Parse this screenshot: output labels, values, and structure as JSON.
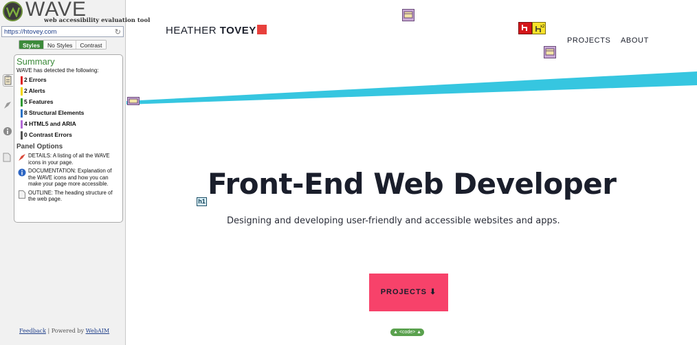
{
  "wave": {
    "logo_word": "WAVE",
    "logo_subtitle": "web accessibility evaluation tool",
    "url": "https://htovey.com",
    "style_toggle": [
      "Styles",
      "No Styles",
      "Contrast"
    ],
    "summary_title": "Summary",
    "summary_intro": "WAVE has detected the following:",
    "counts": [
      {
        "label": "2 Errors",
        "color": "#e02020"
      },
      {
        "label": "2 Alerts",
        "color": "#f2d600"
      },
      {
        "label": "5 Features",
        "color": "#2f9a33"
      },
      {
        "label": "8 Structural Elements",
        "color": "#2b73c6"
      },
      {
        "label": "4 HTML5 and ARIA",
        "color": "#b46ad6"
      },
      {
        "label": "0 Contrast Errors",
        "color": "#555555"
      }
    ],
    "panel_options_title": "Panel Options",
    "options": [
      {
        "icon": "flag-icon",
        "text": "DETAILS: A listing of all the WAVE icons in your page."
      },
      {
        "icon": "info-icon",
        "text": "DOCUMENTATION: Explanation of the WAVE icons and how you can make your page more accessible."
      },
      {
        "icon": "document-icon",
        "text": "OUTLINE: The heading structure of the web page."
      }
    ],
    "footer_feedback": "Feedback",
    "footer_sep": " | Powered by ",
    "footer_webaim": "WebAIM"
  },
  "site": {
    "logo_light": "HEATHER ",
    "logo_bold": "TOVEY",
    "nav": [
      "PROJECTS",
      "ABOUT"
    ],
    "hero_title": "Front-End Web Developer",
    "hero_subtitle": "Designing and developing user-friendly and accessible websites and apps.",
    "cta_label": "PROJECTS ⬇",
    "code_tag": "▲ <code> ▲",
    "h1_tag": "h1"
  },
  "colors": {
    "accent_green": "#3c8a3a",
    "cta_pink": "#f7426a",
    "stripe_cyan": "#36c6e0"
  }
}
